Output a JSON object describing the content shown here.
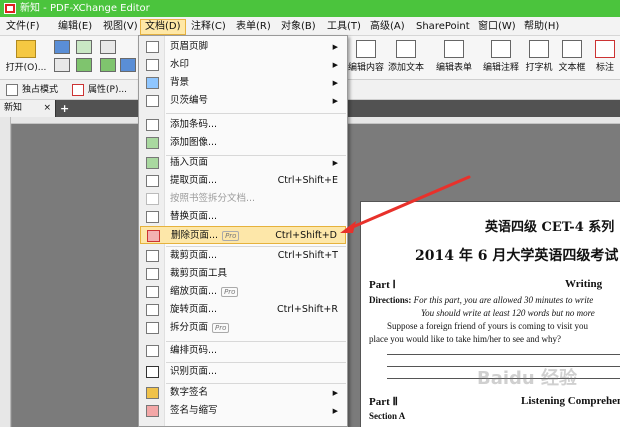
{
  "window": {
    "title": "新知 - PDF-XChange Editor"
  },
  "menubar": {
    "items": [
      "文件(F)",
      "编辑(E)",
      "视图(V)",
      "文档(D)",
      "注释(C)",
      "表单(R)",
      "对象(B)",
      "工具(T)",
      "高级(A)",
      "SharePoint",
      "窗口(W)",
      "帮助(H)"
    ]
  },
  "toolbar": {
    "open_label": "打开(O)...",
    "edit_content": "编辑内容",
    "add_text": "添加文本",
    "edit_form": "编辑表单",
    "edit_annot": "编辑注释",
    "typewriter": "打字机",
    "textbox": "文本框",
    "callout": "标注"
  },
  "toolbar2": {
    "exclusive_mode": "独占模式",
    "properties": "属性(P)..."
  },
  "tabs": {
    "doc_tab": "新知",
    "close": "×",
    "add": "+"
  },
  "dropdown": {
    "pro_badge": "Pro",
    "items": [
      {
        "label": "页眉页脚",
        "shortcut": "",
        "submenu": true,
        "pro": false,
        "disabled": false,
        "highlight": false
      },
      {
        "label": "水印",
        "shortcut": "",
        "submenu": true,
        "pro": false,
        "disabled": false,
        "highlight": false
      },
      {
        "label": "背景",
        "shortcut": "",
        "submenu": true,
        "pro": false,
        "disabled": false,
        "highlight": false
      },
      {
        "label": "贝茨编号",
        "shortcut": "",
        "submenu": true,
        "pro": false,
        "disabled": false,
        "highlight": false
      },
      {
        "label": "添加条码...",
        "shortcut": "",
        "submenu": false,
        "pro": false,
        "disabled": false,
        "highlight": false
      },
      {
        "label": "添加图像...",
        "shortcut": "",
        "submenu": false,
        "pro": false,
        "disabled": false,
        "highlight": false
      },
      {
        "label": "插入页面",
        "shortcut": "",
        "submenu": true,
        "pro": false,
        "disabled": false,
        "highlight": false
      },
      {
        "label": "提取页面...",
        "shortcut": "Ctrl+Shift+E",
        "submenu": false,
        "pro": false,
        "disabled": false,
        "highlight": false
      },
      {
        "label": "按照书签拆分文档...",
        "shortcut": "",
        "submenu": false,
        "pro": false,
        "disabled": true,
        "highlight": false
      },
      {
        "label": "替换页面...",
        "shortcut": "",
        "submenu": false,
        "pro": false,
        "disabled": false,
        "highlight": false
      },
      {
        "label": "删除页面...",
        "shortcut": "Ctrl+Shift+D",
        "submenu": false,
        "pro": true,
        "disabled": false,
        "highlight": true
      },
      {
        "label": "裁剪页面...",
        "shortcut": "Ctrl+Shift+T",
        "submenu": false,
        "pro": false,
        "disabled": false,
        "highlight": false
      },
      {
        "label": "裁剪页面工具",
        "shortcut": "",
        "submenu": false,
        "pro": false,
        "disabled": false,
        "highlight": false
      },
      {
        "label": "缩放页面...",
        "shortcut": "",
        "submenu": false,
        "pro": true,
        "disabled": false,
        "highlight": false
      },
      {
        "label": "旋转页面...",
        "shortcut": "Ctrl+Shift+R",
        "submenu": false,
        "pro": false,
        "disabled": false,
        "highlight": false
      },
      {
        "label": "拆分页面",
        "shortcut": "",
        "submenu": false,
        "pro": true,
        "disabled": false,
        "highlight": false
      },
      {
        "label": "编排页码...",
        "shortcut": "",
        "submenu": false,
        "pro": false,
        "disabled": false,
        "highlight": false
      },
      {
        "label": "识别页面...",
        "shortcut": "",
        "submenu": false,
        "pro": false,
        "disabled": false,
        "highlight": false
      },
      {
        "label": "数字签名",
        "shortcut": "",
        "submenu": true,
        "pro": false,
        "disabled": false,
        "highlight": false
      },
      {
        "label": "签名与缩写",
        "shortcut": "",
        "submenu": true,
        "pro": false,
        "disabled": false,
        "highlight": false
      }
    ]
  },
  "document": {
    "title1": "英语四级 CET-4 系列",
    "title2": "2014 年 6 月大学英语四级考试",
    "part1": "Part Ⅰ",
    "writing": "Writing",
    "directions_label": "Directions:",
    "directions_text": "For this part, you are allowed 30 minutes to write",
    "line2": "You should write at least 120 words but no more",
    "line3": "Suppose a foreign friend of yours is coming to visit you",
    "line4": "place you would like to take him/her to see and why?",
    "part2": "Part Ⅱ",
    "listening": "Listening Comprehension",
    "section_a": "Section A",
    "watermark": "Baidu 经验"
  },
  "colors": {
    "titlebar": "#4bc43d",
    "highlight": "#fde7a9",
    "arrow": "#e8312b"
  }
}
